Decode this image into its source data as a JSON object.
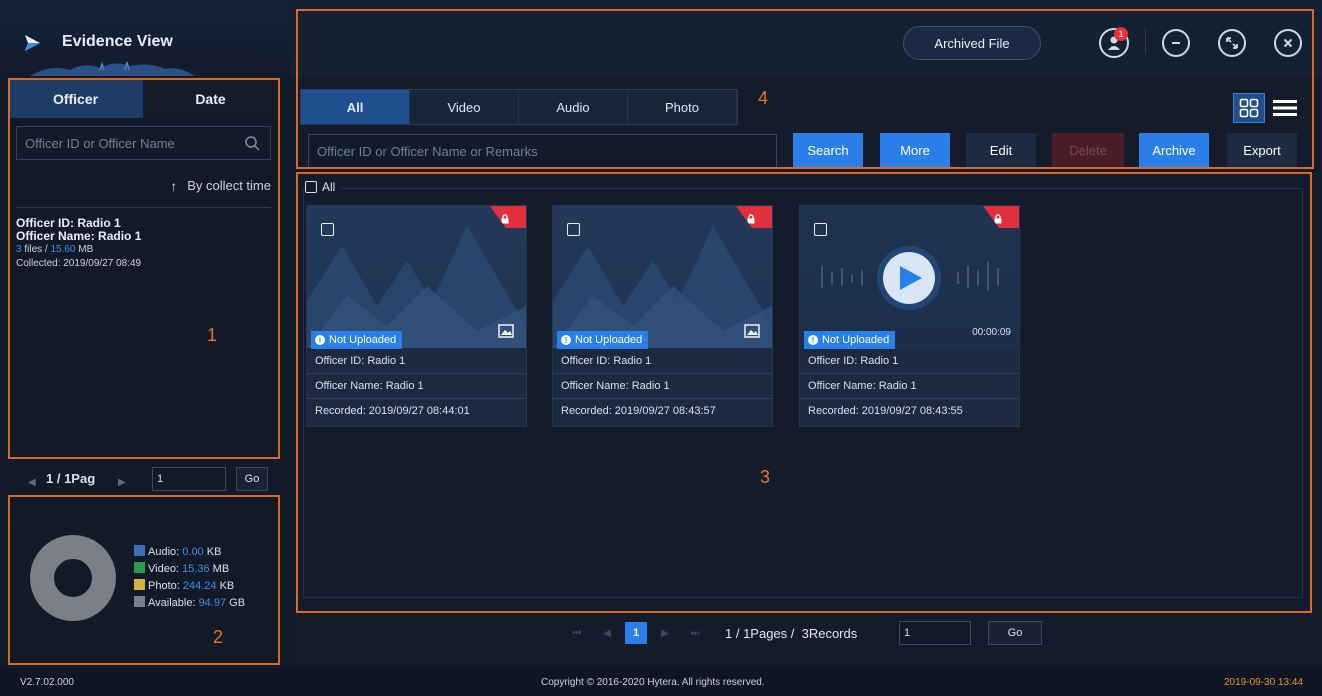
{
  "app": {
    "title": "Evidence View",
    "version": "V2.7.02.000",
    "copyright": "Copyright © 2016-2020 Hytera. All rights reserved.",
    "datetime": "2019-09-30 13:44"
  },
  "topbar": {
    "archived_label": "Archived File",
    "notification_count": "1"
  },
  "left_panel": {
    "tabs": [
      {
        "label": "Officer",
        "active": true
      },
      {
        "label": "Date",
        "active": false
      }
    ],
    "search_placeholder": "Officer ID or Officer Name",
    "sort_label": "By collect time",
    "officers": [
      {
        "id_line": "Officer ID: Radio 1",
        "name_line": "Officer Name: Radio 1",
        "files": "3",
        "files_suffix": " files / ",
        "size": "15.60",
        "size_unit": " MB",
        "collected": "Collected: 2019/09/27 08:49"
      }
    ],
    "pager": {
      "page_text": "1 / 1Pag",
      "page_input": "1",
      "go_label": "Go"
    },
    "storage": {
      "colors": {
        "audio": "#3c6db5",
        "video": "#2f9a4b",
        "photo": "#d4b43a",
        "available": "#7a7f88"
      },
      "items": [
        {
          "label": "Audio:",
          "value": "0.00",
          "unit": "KB"
        },
        {
          "label": "Video:",
          "value": "15.36",
          "unit": "MB"
        },
        {
          "label": "Photo:",
          "value": "244.24",
          "unit": "KB"
        },
        {
          "label": "Available:",
          "value": "94.97",
          "unit": "GB"
        }
      ]
    }
  },
  "filter": {
    "tabs": [
      {
        "label": "All",
        "active": true
      },
      {
        "label": "Video",
        "active": false
      },
      {
        "label": "Audio",
        "active": false
      },
      {
        "label": "Photo",
        "active": false
      }
    ],
    "search_placeholder": "Officer ID or Officer Name or Remarks",
    "buttons": {
      "search": "Search",
      "more": "More",
      "edit": "Edit",
      "delete": "Delete",
      "archive": "Archive",
      "export": "Export"
    }
  },
  "content": {
    "select_all_label": "All",
    "cards": [
      {
        "type": "photo",
        "status": "Not Uploaded",
        "officer_id": "Officer ID: Radio 1",
        "officer_name": "Officer Name: Radio 1",
        "recorded": "Recorded: 2019/09/27 08:44:01",
        "duration": ""
      },
      {
        "type": "photo",
        "status": "Not Uploaded",
        "officer_id": "Officer ID: Radio 1",
        "officer_name": "Officer Name: Radio 1",
        "recorded": "Recorded: 2019/09/27 08:43:57",
        "duration": ""
      },
      {
        "type": "video",
        "status": "Not Uploaded",
        "officer_id": "Officer ID: Radio 1",
        "officer_name": "Officer Name: Radio 1",
        "recorded": "Recorded: 2019/09/27 08:43:55",
        "duration": "00:00:09"
      }
    ]
  },
  "bottom_pager": {
    "current_page": "1",
    "summary": "1 / 1Pages /  3Records",
    "page_input": "1",
    "go_label": "Go"
  },
  "annotations": {
    "region1": "1",
    "region2": "2",
    "region3": "3",
    "region4": "4"
  }
}
